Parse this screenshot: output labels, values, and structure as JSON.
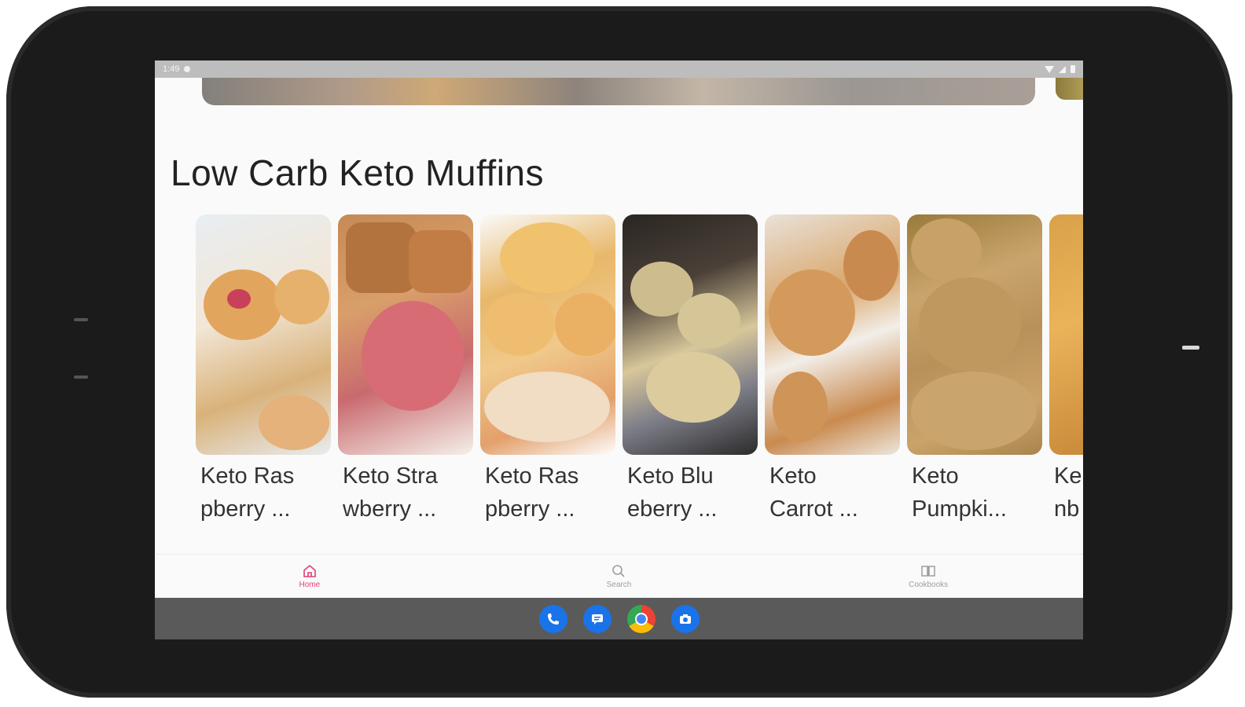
{
  "status_bar": {
    "time": "1:49"
  },
  "section": {
    "title": "Low Carb Keto Muffins"
  },
  "recipes": [
    {
      "name_line1": "Keto Ras",
      "name_line2": "pberry ..."
    },
    {
      "name_line1": "Keto Stra",
      "name_line2": "wberry ..."
    },
    {
      "name_line1": "Keto Ras",
      "name_line2": "pberry ..."
    },
    {
      "name_line1": "Keto Blu",
      "name_line2": "eberry ..."
    },
    {
      "name_line1": "Keto",
      "name_line2": "Carrot ..."
    },
    {
      "name_line1": "Keto",
      "name_line2": "Pumpki..."
    },
    {
      "name_line1": "Ke",
      "name_line2": "nb"
    }
  ],
  "bottom_nav": {
    "items": [
      {
        "label": "Home",
        "icon": "home-icon",
        "active": true
      },
      {
        "label": "Search",
        "icon": "search-icon",
        "active": false
      },
      {
        "label": "Cookbooks",
        "icon": "book-icon",
        "active": false
      }
    ]
  },
  "taskbar": {
    "apps": [
      "phone-icon",
      "messages-icon",
      "chrome-icon",
      "camera-icon"
    ]
  },
  "colors": {
    "accent": "#e0407a",
    "taskbar": "#5a5a5a",
    "status_bar": "#bdbdbd"
  }
}
